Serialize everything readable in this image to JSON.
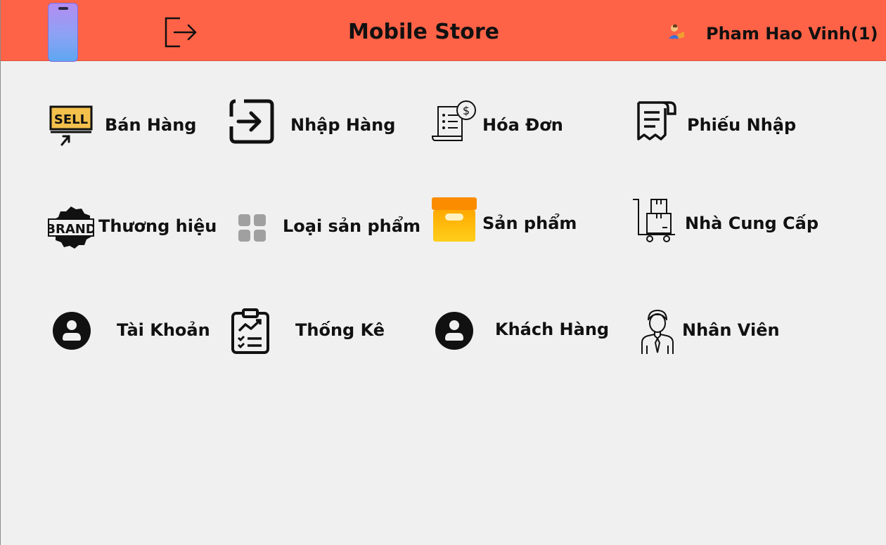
{
  "app": {
    "title": "Mobile Store",
    "user_name": "Pham Hao Vinh(1)",
    "header_color": "#ff6347",
    "icons": [
      "phone-logo-icon",
      "logout-icon",
      "user-avatar-icon"
    ]
  },
  "menu": [
    {
      "key": "sell",
      "label": "Bán Hàng",
      "icon": "sell-sign-icon"
    },
    {
      "key": "import",
      "label": "Nhập Hàng",
      "icon": "import-arrow-icon"
    },
    {
      "key": "invoice",
      "label": "Hóa Đơn",
      "icon": "invoice-receipt-icon"
    },
    {
      "key": "import-slip",
      "label": "Phiếu Nhập",
      "icon": "receipt-slip-icon"
    },
    {
      "key": "brand",
      "label": "Thương hiệu",
      "icon": "brand-badge-icon"
    },
    {
      "key": "category",
      "label": "Loại sản phẩm",
      "icon": "category-grid-icon"
    },
    {
      "key": "product",
      "label": "Sản phẩm",
      "icon": "product-box-icon"
    },
    {
      "key": "supplier",
      "label": "Nhà Cung Cấp",
      "icon": "supplier-hand-truck-icon"
    },
    {
      "key": "account",
      "label": "Tài Khoản",
      "icon": "account-user-icon"
    },
    {
      "key": "statistics",
      "label": "Thống Kê",
      "icon": "statistics-clipboard-icon"
    },
    {
      "key": "customer",
      "label": "Khách Hàng",
      "icon": "customer-user-icon"
    },
    {
      "key": "employee",
      "label": "Nhân Viên",
      "icon": "employee-person-icon"
    }
  ]
}
